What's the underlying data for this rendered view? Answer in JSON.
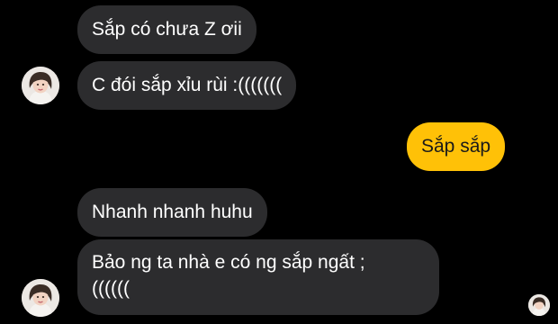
{
  "conversation": {
    "messages": [
      {
        "sender": "contact",
        "text": "Sắp có chưa Z ơii"
      },
      {
        "sender": "contact",
        "text": "C đói sắp xỉu rùi :((((((("
      },
      {
        "sender": "me",
        "text": "Sắp sắp"
      },
      {
        "sender": "contact",
        "text": "Nhanh nhanh huhu"
      },
      {
        "sender": "contact",
        "text": "Bảo ng ta nhà e có ng sắp ngất ;\n(((((("
      }
    ]
  },
  "colors": {
    "background": "#000000",
    "incoming_bubble": "#2c2c2e",
    "outgoing_bubble": "#ffc107"
  },
  "icons": {
    "contact_avatar": "contact-avatar-photo",
    "read_receipt_avatar": "read-receipt-avatar-photo"
  }
}
